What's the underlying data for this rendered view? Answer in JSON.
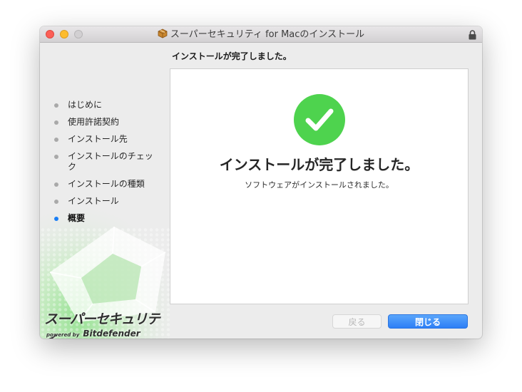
{
  "window": {
    "title": "スーパーセキュリティ for Macのインストール",
    "icons": {
      "package": "package-icon",
      "lock": "lock-icon"
    }
  },
  "header": {
    "step_title": "インストールが完了しました。"
  },
  "sidebar": {
    "steps": [
      {
        "label": "はじめに",
        "active": false
      },
      {
        "label": "使用許諾契約",
        "active": false
      },
      {
        "label": "インストール先",
        "active": false
      },
      {
        "label": "インストールのチェック",
        "active": false
      },
      {
        "label": "インストールの種類",
        "active": false
      },
      {
        "label": "インストール",
        "active": false
      },
      {
        "label": "概要",
        "active": true
      }
    ],
    "brand": {
      "name": "スーパーセキュリティ",
      "powered_by": "powered by",
      "vendor": "Bitdefender"
    }
  },
  "main": {
    "success_icon": "check-circle-icon",
    "title": "インストールが完了しました。",
    "subtitle": "ソフトウェアがインストールされました。"
  },
  "buttons": {
    "back": {
      "label": "戻る",
      "enabled": false
    },
    "close": {
      "label": "閉じる",
      "enabled": true
    }
  },
  "colors": {
    "success_green": "#4ed34e",
    "primary_button": "#2d7ef6",
    "active_step_dot": "#1a7ef5"
  }
}
